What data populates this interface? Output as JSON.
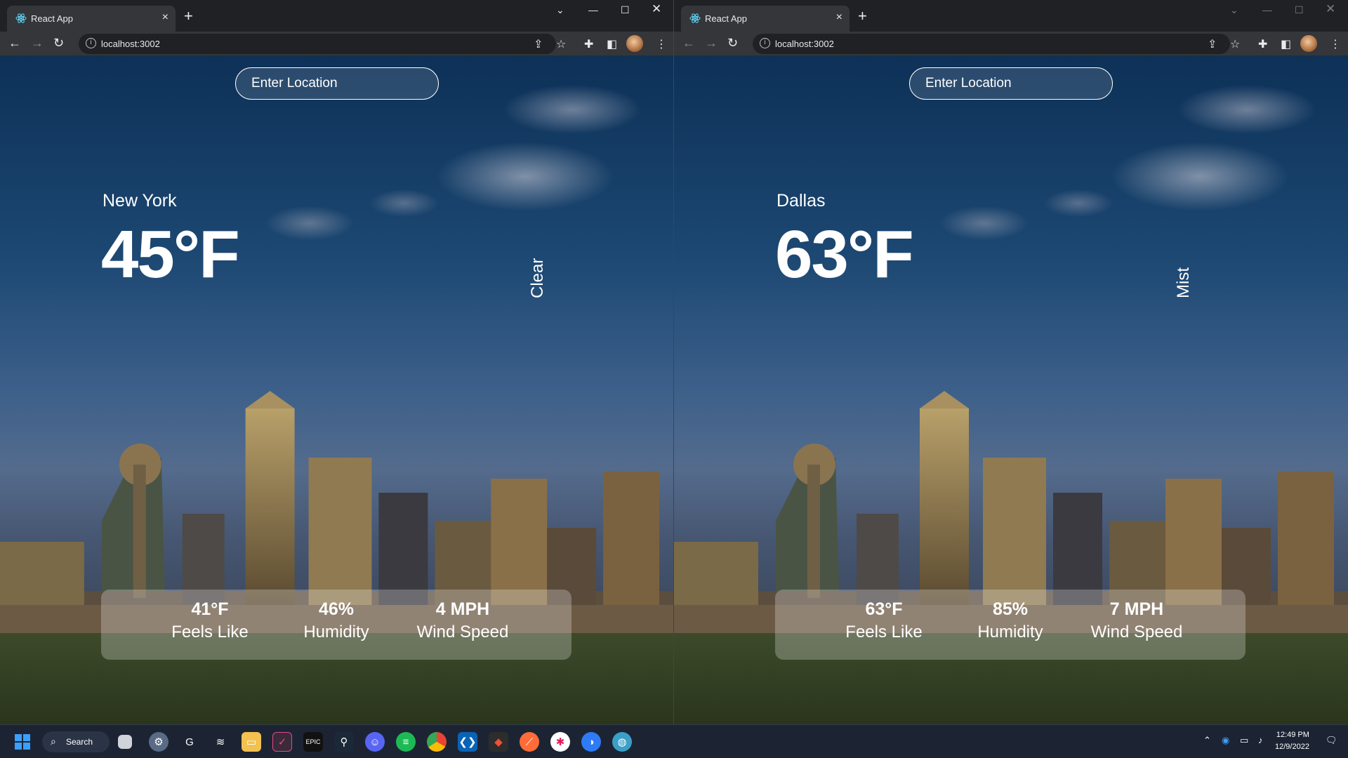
{
  "browser": {
    "tab_title": "React App",
    "url": "localhost:3002",
    "new_tab_symbol": "+",
    "close_symbol": "×",
    "info_symbol": "i"
  },
  "panes": [
    {
      "search_placeholder": "Enter Location",
      "city": "New York",
      "temperature": "45°F",
      "condition": "Clear",
      "stats": [
        {
          "value": "41°F",
          "label": "Feels Like"
        },
        {
          "value": "46%",
          "label": "Humidity"
        },
        {
          "value": "4 MPH",
          "label": "Wind Speed"
        }
      ]
    },
    {
      "search_placeholder": "Enter Location",
      "city": "Dallas",
      "temperature": "63°F",
      "condition": "Mist",
      "stats": [
        {
          "value": "63°F",
          "label": "Feels Like"
        },
        {
          "value": "85%",
          "label": "Humidity"
        },
        {
          "value": "7 MPH",
          "label": "Wind Speed"
        }
      ]
    }
  ],
  "taskbar": {
    "search_label": "Search",
    "time": "12:49 PM",
    "date": "12/9/2022"
  },
  "colors": {
    "accent_blue": "#0b62d6",
    "chrome_dark": "#202124",
    "chrome_toolbar": "#35363a"
  }
}
